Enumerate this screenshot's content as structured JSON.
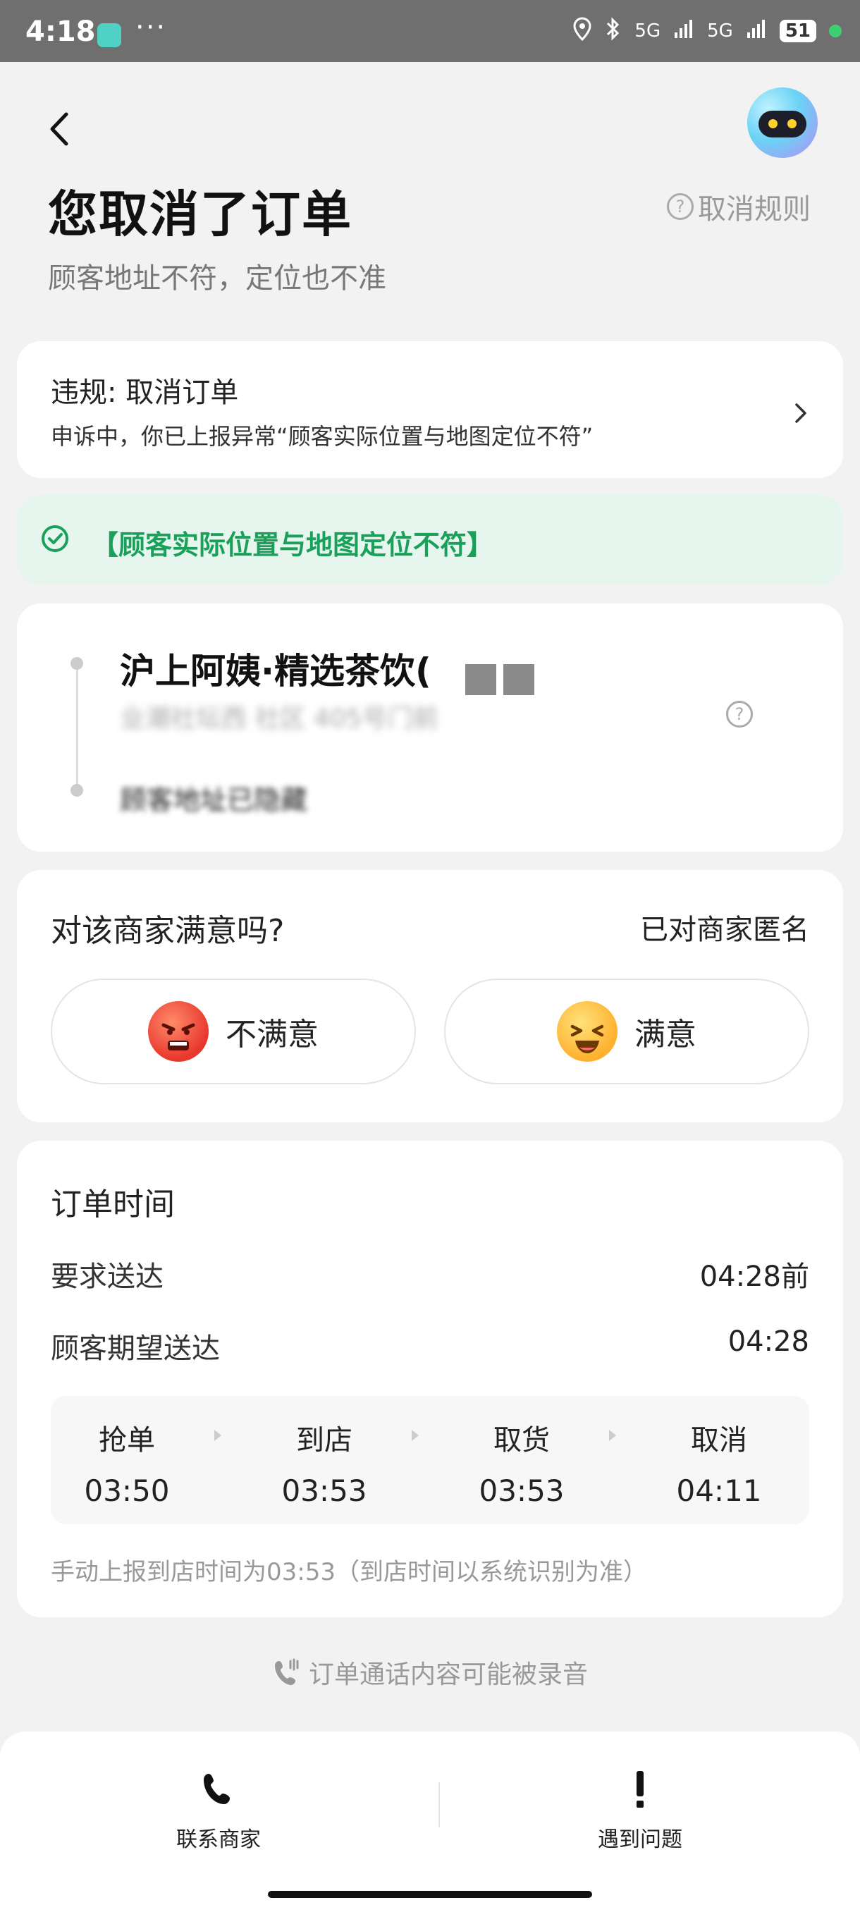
{
  "status_bar": {
    "time": "4:18",
    "dots": "···",
    "network": "5G",
    "battery": "51"
  },
  "header": {
    "title": "您取消了订单",
    "rules_link": "取消规则",
    "subtitle": "顾客地址不符，定位也不准"
  },
  "violation": {
    "title": "违规: 取消订单",
    "desc": "申诉中，你已上报异常“顾客实际位置与地图定位不符”"
  },
  "reason_tag": "【顾客实际位置与地图定位不符】",
  "route": {
    "shop_name": "沪上阿姨·精选茶饮(",
    "shop_addr": "业潮社坛西 社区 405号门前",
    "customer_addr": "顾客地址已隐藏"
  },
  "satisfaction": {
    "question": "对该商家满意吗?",
    "anonymous": "已对商家匿名",
    "unsatisfied": "不满意",
    "satisfied": "满意"
  },
  "order_time": {
    "title": "订单时间",
    "rows": [
      {
        "label": "要求送达",
        "value": "04:28前"
      },
      {
        "label": "顾客期望送达",
        "value": "04:28"
      }
    ],
    "steps": [
      {
        "label": "抢单",
        "time": "03:50"
      },
      {
        "label": "到店",
        "time": "03:53"
      },
      {
        "label": "取货",
        "time": "03:53"
      },
      {
        "label": "取消",
        "time": "04:11"
      }
    ],
    "manual_note": "手动上报到店时间为03:53（到店时间以系统识别为准）"
  },
  "recording_note": "订单通话内容可能被录音",
  "bottom": {
    "contact": "联系商家",
    "problem": "遇到问题"
  },
  "colors": {
    "accent_green": "#1aa05a",
    "green_bg": "#e6f6ee",
    "background": "#f2f2f2"
  },
  "icons": [
    "back-icon",
    "robot-icon",
    "question-icon",
    "chevron-right-icon",
    "check-circle-icon",
    "phone-icon",
    "exclamation-icon",
    "phone-record-icon"
  ]
}
